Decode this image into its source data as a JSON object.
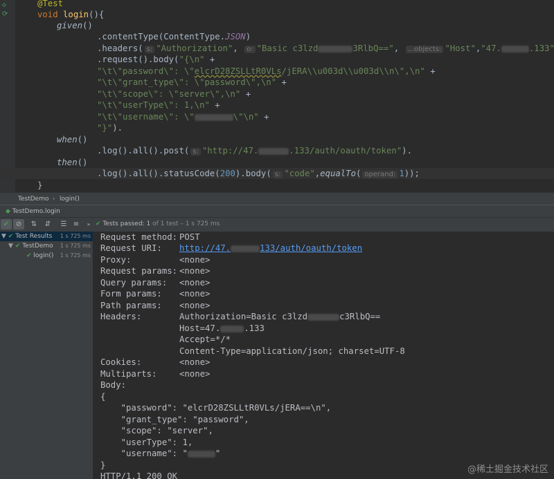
{
  "editor": {
    "lines": [
      {
        "annotation": "@Test"
      },
      {
        "kw": "void",
        "fn": "login",
        "rest": "(){"
      },
      {
        "fn": "given",
        "rest": "()"
      },
      {
        "pre": ".contentType(ContentType.",
        "field": "JSON",
        "post": ")"
      },
      {
        "pre": ".headers(",
        "hint1": "s:",
        "s1": "\"Authorization\"",
        "sep1": ", ",
        "hint2": "o:",
        "s2a": "\"Basic c3lzd",
        "s2b": "3RlbQ==\"",
        "sep2": ", ",
        "hint3": "...objects:",
        "s3": "\"Host\"",
        "sep3": ",",
        "s4a": "\"47.",
        "s4b": ".133\"",
        "post": ")"
      },
      {
        "pre": ".request().body(",
        "str": "\"{\\n\"",
        "post": " +"
      },
      {
        "str_a": "\"\\t\\\"password\\\": \\\"",
        "str_u": "elcrD28ZSLLtR0VLs",
        "str_b": "/jERA\\\\u003d\\\\u003d\\\\n\\\",\\n\"",
        "post": " +"
      },
      {
        "str": "\"\\t\\\"grant_type\\\": \\\"password\\\",\\n\"",
        "post": " +"
      },
      {
        "str": "\"\\t\\\"scope\\\": \\\"server\\\",\\n\"",
        "post": " +"
      },
      {
        "str": "\"\\t\\\"userType\\\": 1,\\n\"",
        "post": " +"
      },
      {
        "str_a": "\"\\t\\\"username\\\": \\\"",
        "str_b": "\\\"\\n\"",
        "post": " +"
      },
      {
        "str": "\"}\"",
        "post": ")."
      },
      {
        "fn": "when",
        "rest": "()"
      },
      {
        "pre": ".log().all().post(",
        "hint1": "s:",
        "s1a": "\"http://47.",
        "s1b": ".133/auth/oauth/token\"",
        "post": ")."
      },
      {
        "fn": "then",
        "rest": "()"
      },
      {
        "pre": ".log().all().statusCode(",
        "num": "200",
        "mid": ").body(",
        "hint1": "s:",
        "s1": "\"code\"",
        "sep1": ",",
        "fn2": "equalTo",
        "paren": "(",
        "hint2": "operand:",
        "num2": "1",
        "post": "));"
      },
      {
        "rest": "}"
      }
    ]
  },
  "breadcrumb": {
    "class_name": "TestDemo",
    "method_name": "login()"
  },
  "run_tab": {
    "label": "TestDemo.login"
  },
  "toolbar": {
    "status_label": "Tests passed:",
    "status_count": "1",
    "status_detail": "of 1 test – 1 s 725 ms"
  },
  "tree": {
    "items": [
      {
        "label": "Test Results",
        "time": "1 s 725 ms"
      },
      {
        "label": "TestDemo",
        "time": "1 s 725 ms"
      },
      {
        "label": "login()",
        "time": "1 s 725 ms"
      }
    ]
  },
  "console": {
    "request_method_label": "Request method:",
    "request_method": "POST",
    "request_uri_label": "Request URI:",
    "request_uri_a": "http://47.",
    "request_uri_b": "133/auth/oauth/token",
    "proxy_label": "Proxy:",
    "proxy": "<none>",
    "request_params_label": "Request params:",
    "request_params": "<none>",
    "query_params_label": "Query params:",
    "query_params": "<none>",
    "form_params_label": "Form params:",
    "form_params": "<none>",
    "path_params_label": "Path params:",
    "path_params": "<none>",
    "headers_label": "Headers:",
    "header_auth_a": "Authorization=Basic c3lzd",
    "header_auth_b": "c3RlbQ==",
    "header_host_a": "Host=47.",
    "header_host_b": ".133",
    "header_accept": "Accept=*/*",
    "header_content_type": "Content-Type=application/json; charset=UTF-8",
    "cookies_label": "Cookies:",
    "cookies": "<none>",
    "multiparts_label": "Multiparts:",
    "multiparts": "<none>",
    "body_label": "Body:",
    "body_open": "{",
    "body_password": "    \"password\": \"elcrD28ZSLLtR0VLs/jERA==\\n\",",
    "body_grant_type": "    \"grant_type\": \"password\",",
    "body_scope": "    \"scope\": \"server\",",
    "body_user_type": "    \"userType\": 1,",
    "body_username_a": "    \"username\": \"",
    "body_username_b": "\"",
    "body_close": "}",
    "http_status": "HTTP/1.1 200 OK"
  },
  "watermark": "@稀土掘金技术社区"
}
